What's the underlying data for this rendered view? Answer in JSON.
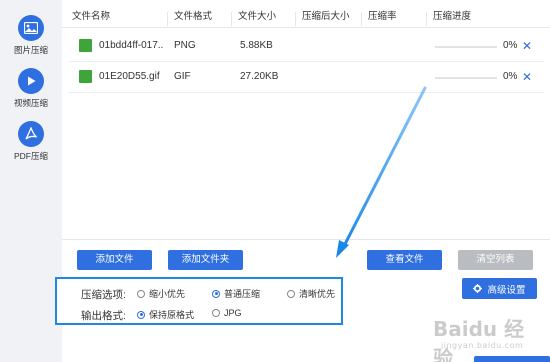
{
  "sidebar": {
    "items": [
      {
        "label": "图片压缩",
        "icon": "image-icon"
      },
      {
        "label": "视频压缩",
        "icon": "play-icon"
      },
      {
        "label": "PDF压缩",
        "icon": "pdf-icon"
      }
    ]
  },
  "table": {
    "headers": [
      "文件名称",
      "文件格式",
      "文件大小",
      "压缩后大小",
      "压缩率",
      "压缩进度"
    ],
    "rows": [
      {
        "name": "01bdd4ff-017..",
        "format": "PNG",
        "size": "5.88KB",
        "compressed_size": "",
        "ratio": "",
        "progress": 0,
        "progress_text": "0%"
      },
      {
        "name": "01E20D55.gif",
        "format": "GIF",
        "size": "27.20KB",
        "compressed_size": "",
        "ratio": "",
        "progress": 0,
        "progress_text": "0%"
      }
    ]
  },
  "buttons": {
    "add_file": "添加文件",
    "add_folder": "添加文件夹",
    "view_files": "查看文件",
    "clear_list": "清空列表",
    "advanced": "高级设置"
  },
  "options": {
    "compress_label": "压缩选项:",
    "compress_choices": [
      {
        "label": "缩小优先",
        "checked": false
      },
      {
        "label": "普通压缩",
        "checked": true
      },
      {
        "label": "清晰优先",
        "checked": false
      }
    ],
    "format_label": "输出格式:",
    "format_choices": [
      {
        "label": "保持原格式",
        "checked": true
      },
      {
        "label": "JPG",
        "checked": false
      }
    ]
  },
  "watermark": {
    "line1": "Baidu 经验",
    "line2": "jingyan.baidu.com"
  },
  "colors": {
    "accent": "#2f6fe0",
    "highlight_border": "#1e88e5",
    "gray_button": "#b9bcc1",
    "file_icon": "#3fa53a"
  }
}
